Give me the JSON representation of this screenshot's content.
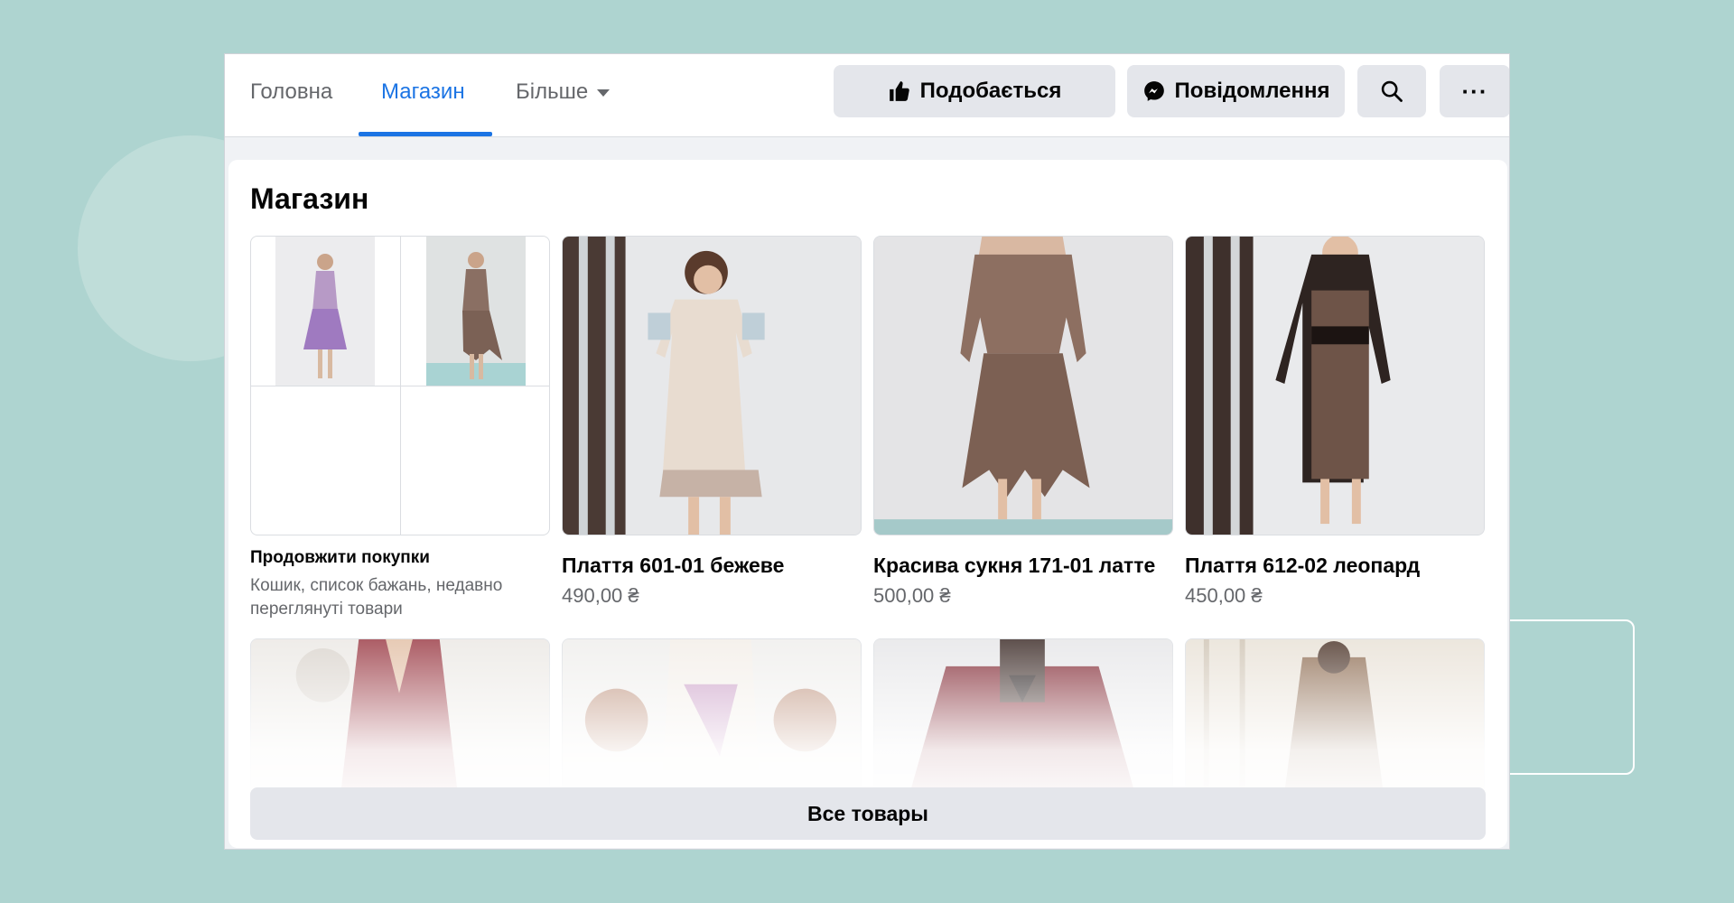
{
  "nav": {
    "tabs": [
      {
        "label": "Головна"
      },
      {
        "label": "Магазин"
      },
      {
        "label": "Більше"
      }
    ],
    "like_label": "Подобається",
    "message_label": "Повідомлення",
    "more_label": "···"
  },
  "shop": {
    "title": "Магазин",
    "continue": {
      "title": "Продовжити покупки",
      "subtitle_line1": "Кошик, список бажань, недавно",
      "subtitle_line2": "переглянуті товари"
    },
    "products": [
      {
        "name": "Плаття 601-01 бежеве",
        "price": "490,00 ₴"
      },
      {
        "name": "Красива сукня 171-01 латте",
        "price": "500,00 ₴"
      },
      {
        "name": "Плаття 612-02 леопард",
        "price": "450,00 ₴"
      }
    ],
    "all_button": "Все товары"
  },
  "colors": {
    "accent": "#1b74e4",
    "background": "#aed4d0",
    "button_bg": "#e4e6eb"
  }
}
